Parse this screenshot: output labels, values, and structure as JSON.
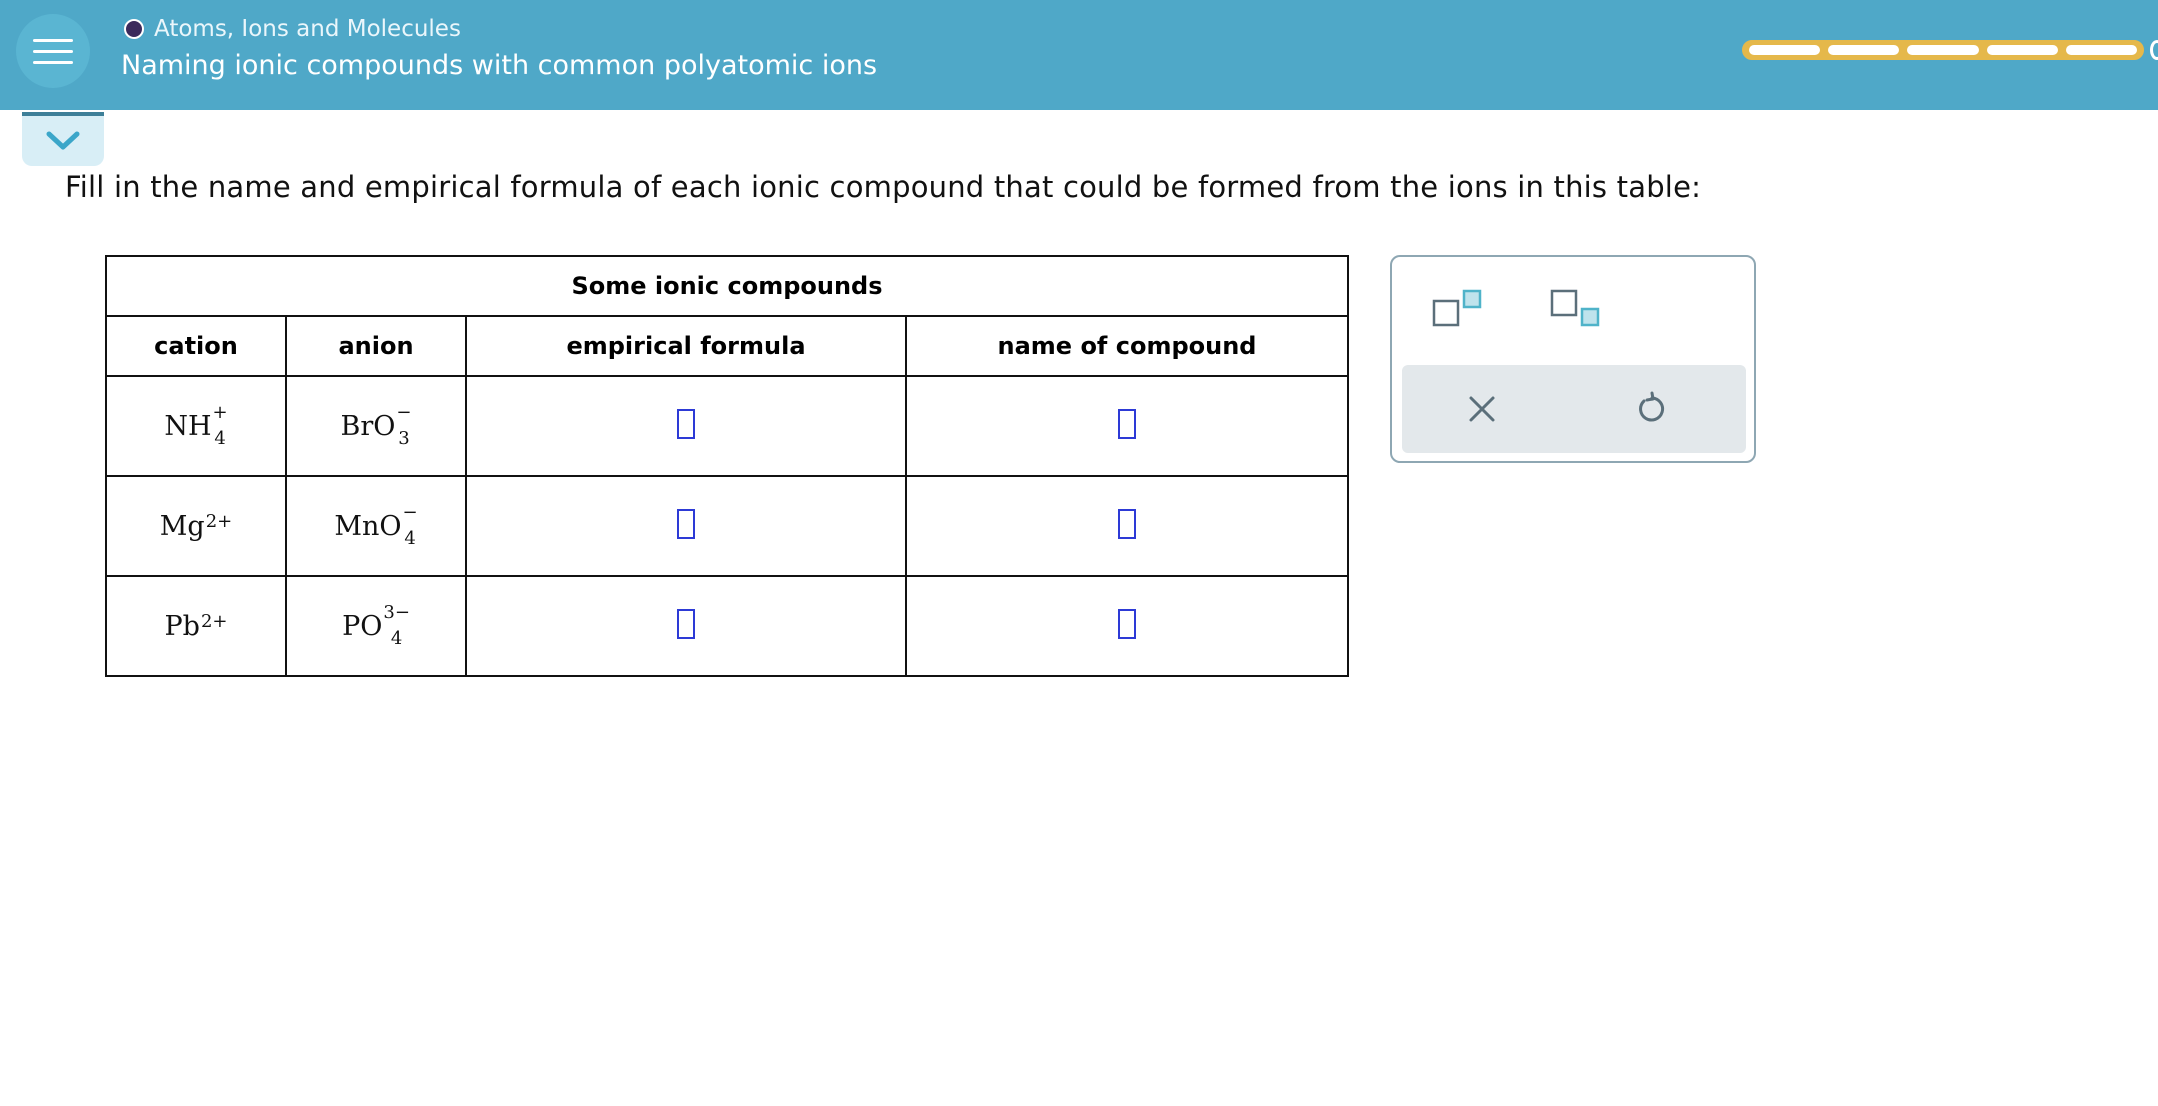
{
  "header": {
    "breadcrumb": "Atoms, Ions and Molecules",
    "subtitle": "Naming ionic compounds with common polyatomic ions",
    "progress_segments": 5,
    "colors": {
      "bar": "#4fa8c8",
      "progress": "#e5b84a",
      "dot": "#3b2a5c"
    }
  },
  "question": {
    "instruction": "Fill in the name and empirical formula of each ionic compound that could be formed from the ions in this table:"
  },
  "table": {
    "caption": "Some ionic compounds",
    "headers": [
      "cation",
      "anion",
      "empirical formula",
      "name of compound"
    ],
    "rows": [
      {
        "cation": {
          "base": "NH",
          "sub": "4",
          "sup": "+"
        },
        "anion": {
          "base": "BrO",
          "sub": "3",
          "sup": "−"
        },
        "formula": "",
        "name": ""
      },
      {
        "cation": {
          "base": "Mg",
          "sub": "",
          "sup": "2+"
        },
        "anion": {
          "base": "MnO",
          "sub": "4",
          "sup": "−"
        },
        "formula": "",
        "name": ""
      },
      {
        "cation": {
          "base": "Pb",
          "sub": "",
          "sup": "2+"
        },
        "anion": {
          "base": "PO",
          "sub": "4",
          "sup": "3−"
        },
        "formula": "",
        "name": ""
      }
    ]
  },
  "toolbar": {
    "icons": [
      "superscript-icon",
      "subscript-icon",
      "clear-icon",
      "undo-icon"
    ],
    "colors": {
      "accent": "#4fb3c9",
      "icon": "#5b6f7a",
      "panel_border": "#8ea7b3"
    }
  }
}
